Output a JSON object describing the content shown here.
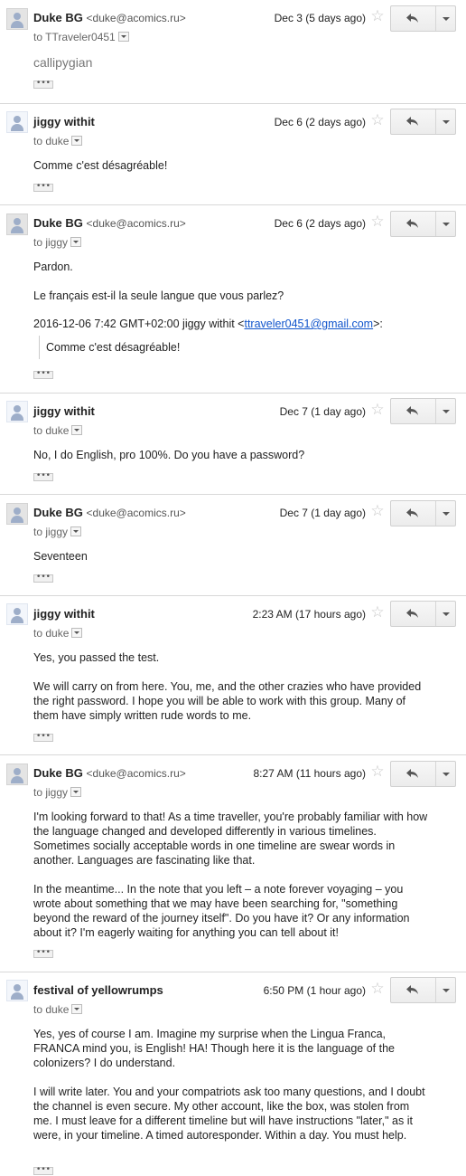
{
  "messages": [
    {
      "sender_name": "Duke BG",
      "sender_email": "<duke@acomics.ru>",
      "date": "Dec 3 (5 days ago)",
      "to": "to TTraveler0451",
      "body": [
        "callipygian"
      ]
    },
    {
      "sender_name": "jiggy withit",
      "sender_email": "",
      "date": "Dec 6 (2 days ago)",
      "to": "to duke",
      "body": [
        "Comme c'est désagréable!"
      ]
    },
    {
      "sender_name": "Duke BG",
      "sender_email": "<duke@acomics.ru>",
      "date": "Dec 6 (2 days ago)",
      "to": "to jiggy",
      "body": [
        "Pardon.",
        "Le français est-il la seule langue que vous parlez?"
      ],
      "quote_header_prefix": "2016-12-06 7:42 GMT+02:00 jiggy withit <",
      "quote_link": "ttraveler0451@gmail.com",
      "quote_header_suffix": ">:",
      "quote_text": "Comme c'est désagréable!"
    },
    {
      "sender_name": "jiggy withit",
      "sender_email": "",
      "date": "Dec 7 (1 day ago)",
      "to": "to duke",
      "body": [
        "No, I do English, pro 100%. Do you have a password?"
      ]
    },
    {
      "sender_name": "Duke BG",
      "sender_email": "<duke@acomics.ru>",
      "date": "Dec 7 (1 day ago)",
      "to": "to jiggy",
      "body": [
        "Seventeen"
      ]
    },
    {
      "sender_name": "jiggy withit",
      "sender_email": "",
      "date": "2:23 AM (17 hours ago)",
      "to": "to duke",
      "body": [
        "Yes, you passed the test.",
        "We will carry on from here. You, me, and the other crazies who have provided the right password. I hope you will be able to work with this group. Many of them have simply written rude words to me."
      ]
    },
    {
      "sender_name": "Duke BG",
      "sender_email": "<duke@acomics.ru>",
      "date": "8:27 AM (11 hours ago)",
      "to": "to jiggy",
      "body": [
        "I'm looking forward to that! As a time traveller, you're probably familiar with how the language changed and developed differently in various timelines. Sometimes socially acceptable words in one timeline are swear words in another. Languages are fascinating like that.",
        "In the meantime... In the note that you left – a note forever voyaging – you wrote about something that we may have been searching for, \"something beyond the reward of the journey itself\". Do you have it? Or any information about it? I'm eagerly waiting for anything you can tell about it!"
      ]
    },
    {
      "sender_name": "festival of yellowrumps",
      "sender_email": "",
      "date": "6:50 PM (1 hour ago)",
      "to": "to duke",
      "body": [
        "Yes, yes of course I am. Imagine my surprise when the Lingua Franca, FRANCA mind you, is English! HA! Though here it is the language of the colonizers? I do understand.",
        "I will write later. You and your compatriots ask too many questions, and I doubt the channel is even secure. My other account, like the box, was stolen from me. I must leave for a different timeline but will have instructions \"later,\" as it were, in your timeline. A timed autoresponder. Within a day. You must help."
      ]
    }
  ],
  "ellipsis_label": "•••",
  "star_glyph": "☆",
  "icons": [
    "person-avatar-icon",
    "star-icon",
    "reply-arrow-icon",
    "chevron-down-icon"
  ]
}
